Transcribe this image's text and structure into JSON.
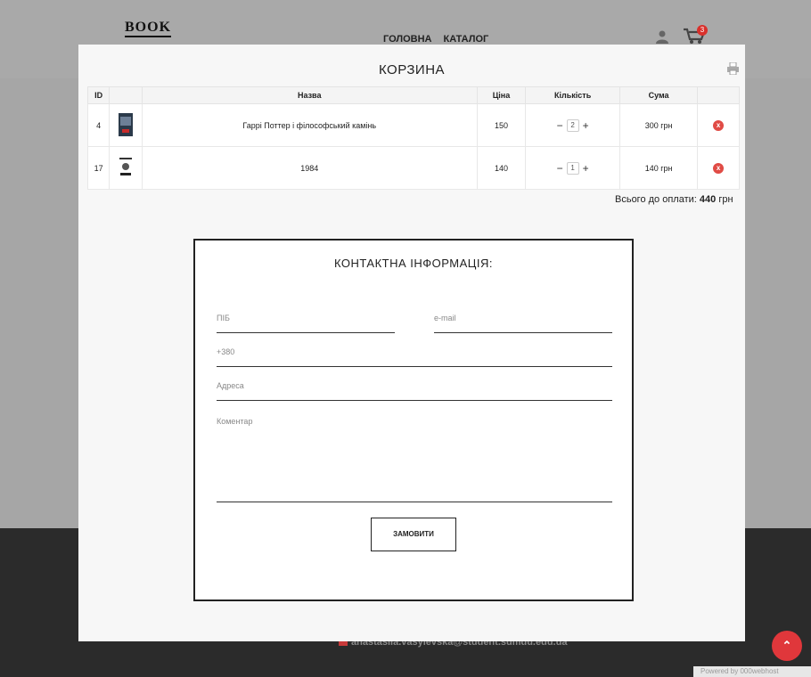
{
  "site": {
    "logo": "BOOK",
    "nav": [
      "ГОЛОВНА",
      "КАТАЛОГ"
    ],
    "cart_count": "3",
    "footer_email": "anastasiia.vasylevska@student.sumdu.edu.ua",
    "powered": "Powered by 000webhost"
  },
  "modal": {
    "title": "КОРЗИНА",
    "columns": [
      "ID",
      "",
      "Назва",
      "Ціна",
      "Кількість",
      "Сума",
      ""
    ],
    "rows": [
      {
        "id": "4",
        "name": "Гаррі Поттер і філософський камінь",
        "price": "150",
        "qty": "2",
        "sum": "300 грн",
        "delete": "x"
      },
      {
        "id": "17",
        "name": "1984",
        "price": "140",
        "qty": "1",
        "sum": "140 грн",
        "delete": "x"
      }
    ],
    "qty_minus": "−",
    "qty_plus": "+",
    "total_label": "Всього до оплати:",
    "total_value": "440",
    "total_currency": "грн"
  },
  "form": {
    "title": "КОНТАКТНА ІНФОРМАЦІЯ:",
    "name_placeholder": "ПІБ",
    "email_placeholder": "e-mail",
    "phone_placeholder": "+380",
    "address_placeholder": "Адреса",
    "comment_placeholder": "Коментар",
    "submit_label": "ЗАМОВИТИ"
  }
}
